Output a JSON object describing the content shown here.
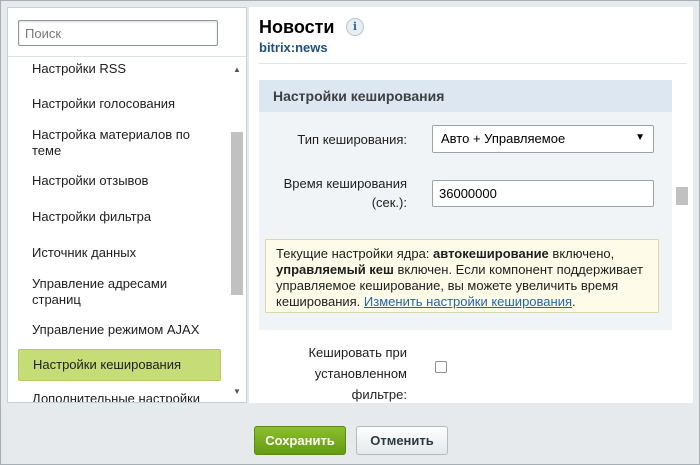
{
  "search": {
    "placeholder": "Поиск"
  },
  "sidebar": {
    "items": [
      {
        "label": "Настройки RSS"
      },
      {
        "label": "Настройки голосования"
      },
      {
        "label": "Настройка материалов по теме"
      },
      {
        "label": "Настройки отзывов"
      },
      {
        "label": "Настройки фильтра"
      },
      {
        "label": "Источник данных"
      },
      {
        "label": "Управление адресами страниц"
      },
      {
        "label": "Управление режимом AJAX"
      },
      {
        "label": "Настройки кеширования"
      },
      {
        "label": "Дополнительные настройки"
      }
    ],
    "active_index": 8
  },
  "header": {
    "title": "Новости",
    "info_icon": "i",
    "subtitle": "bitrix:news"
  },
  "panel": {
    "title": "Настройки кеширования",
    "cache_type_label": "Тип кеширования:",
    "cache_type_value": "Авто + Управляемое",
    "cache_time_label_1": "Время кеширования",
    "cache_time_label_2": "(сек.):",
    "cache_time_value": "36000000",
    "notice": {
      "t1": "Текущие настройки ядра: ",
      "b1": "автокеширование",
      "t2": " включено, ",
      "b2": "управляемый кеш",
      "t3": " включен. Если компонент поддерживает управляемое кеширование, вы можете увеличить время кеширования. ",
      "link": "Изменить настройки кеширования",
      "t4": "."
    }
  },
  "filter_cache": {
    "label_1": "Кешировать при",
    "label_2": "установленном",
    "label_3": "фильтре:",
    "checked": false
  },
  "footer": {
    "save_label": "Сохранить",
    "cancel_label": "Отменить"
  },
  "colors": {
    "accent_green": "#6aa014",
    "active_item": "#c6dd77",
    "panel_header": "#dce7f1",
    "notice_bg": "#fefce8",
    "link": "#2067b0"
  }
}
